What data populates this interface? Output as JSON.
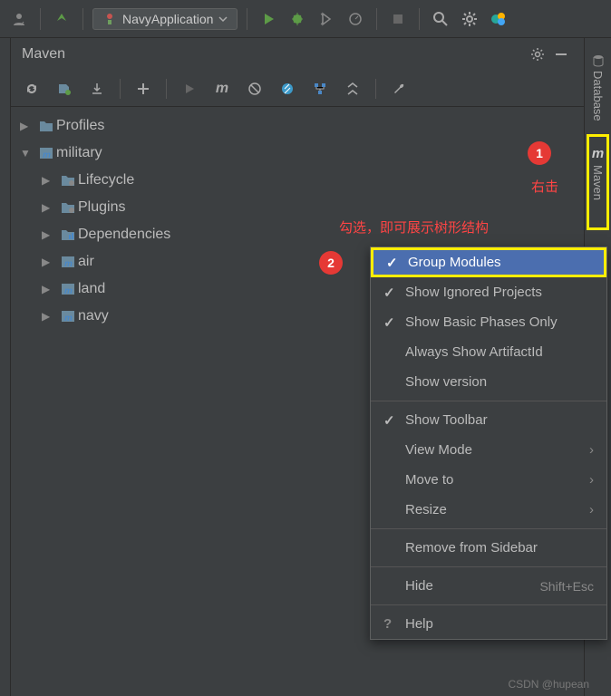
{
  "top": {
    "run_config": "NavyApplication"
  },
  "panel": {
    "title": "Maven"
  },
  "tree": {
    "profiles": "Profiles",
    "root": "military",
    "children": [
      {
        "label": "Lifecycle",
        "icon": "folder-gear"
      },
      {
        "label": "Plugins",
        "icon": "folder-gear"
      },
      {
        "label": "Dependencies",
        "icon": "folder-deps"
      },
      {
        "label": "air",
        "icon": "maven-module"
      },
      {
        "label": "land",
        "icon": "maven-module"
      },
      {
        "label": "navy",
        "icon": "maven-module"
      }
    ]
  },
  "menu": {
    "items": [
      {
        "label": "Group Modules",
        "checked": true,
        "selected": true
      },
      {
        "label": "Show Ignored Projects",
        "checked": true
      },
      {
        "label": "Show Basic Phases Only",
        "checked": true
      },
      {
        "label": "Always Show ArtifactId",
        "checked": false
      },
      {
        "label": "Show version",
        "checked": false
      }
    ],
    "items2": [
      {
        "label": "Show Toolbar",
        "checked": true
      },
      {
        "label": "View Mode",
        "submenu": true
      },
      {
        "label": "Move to",
        "submenu": true
      },
      {
        "label": "Resize",
        "submenu": true
      }
    ],
    "remove": "Remove from Sidebar",
    "hide": "Hide",
    "hide_shortcut": "Shift+Esc",
    "help": "Help"
  },
  "right_tabs": {
    "database": "Database",
    "maven": "Maven"
  },
  "annotations": {
    "badge1": "1",
    "badge2": "2",
    "text1": "右击",
    "text2": "勾选，即可展示树形结构"
  },
  "watermark": "CSDN @hupean"
}
